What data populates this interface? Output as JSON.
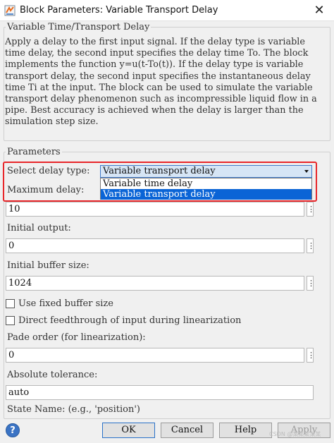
{
  "window": {
    "title": "Block Parameters: Variable Transport Delay",
    "close_glyph": "✕"
  },
  "description": {
    "legend": "Variable Time/Transport Delay",
    "text": "Apply a delay to the first input signal.  If the delay type is variable time delay, the second input specifies the delay time To. The block implements the function y=u(t-To(t)).  If the delay type is variable transport delay, the second input specifies the instantaneous delay time Ti at the input. The block can be used to simulate the variable transport delay phenomenon such as incompressible liquid flow in a pipe. Best accuracy is achieved when the delay is larger than the simulation step size."
  },
  "parameters": {
    "legend": "Parameters",
    "delay_type": {
      "label": "Select delay type:",
      "value": "Variable transport delay",
      "options": [
        "Variable time delay",
        "Variable transport delay"
      ]
    },
    "maximum_delay": {
      "label": "Maximum delay:",
      "value": "10"
    },
    "initial_output": {
      "label": "Initial output:",
      "value": "0"
    },
    "initial_buffer_size": {
      "label": "Initial buffer size:",
      "value": "1024"
    },
    "use_fixed_buffer_size": {
      "label": "Use fixed buffer size",
      "checked": false
    },
    "direct_feedthrough": {
      "label": "Direct feedthrough of input during linearization",
      "checked": false
    },
    "pade_order": {
      "label": "Pade order (for linearization):",
      "value": "0"
    },
    "absolute_tolerance": {
      "label": "Absolute tolerance:",
      "value": "auto"
    },
    "state_name": {
      "label": "State Name: (e.g., 'position')"
    }
  },
  "buttons": {
    "ok": "OK",
    "cancel": "Cancel",
    "help": "Help",
    "apply": "Apply"
  },
  "more_glyph": "⋮",
  "help_glyph": "?",
  "watermark": "CSDN @某某某某某",
  "colors": {
    "highlight": "#e8262a",
    "selection": "#0a64d6",
    "select_bg": "#d6e5f5"
  }
}
